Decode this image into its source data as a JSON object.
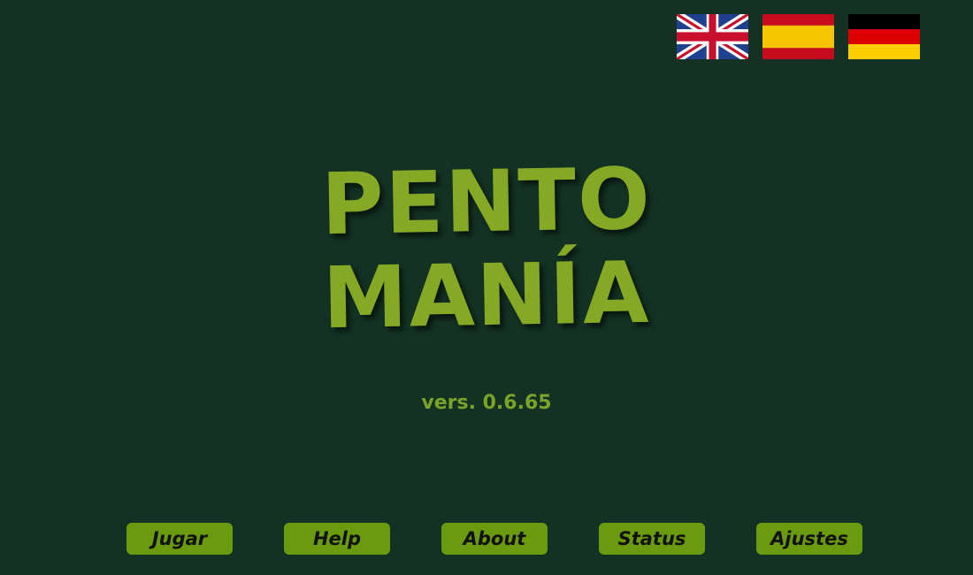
{
  "languages": [
    {
      "name": "English",
      "icon": "uk-flag-icon"
    },
    {
      "name": "Español",
      "icon": "spain-flag-icon"
    },
    {
      "name": "Deutsch",
      "icon": "germany-flag-icon"
    }
  ],
  "title": {
    "line1": "PENTO",
    "line2": "MANÍA"
  },
  "version": "vers. 0.6.65",
  "buttons": {
    "play": "Jugar",
    "help": "Help",
    "about": "About",
    "status": "Status",
    "settings": "Ajustes"
  },
  "colors": {
    "background": "#133223",
    "title": "#86a925",
    "button": "#6a9b0f",
    "version": "#7ba329"
  }
}
